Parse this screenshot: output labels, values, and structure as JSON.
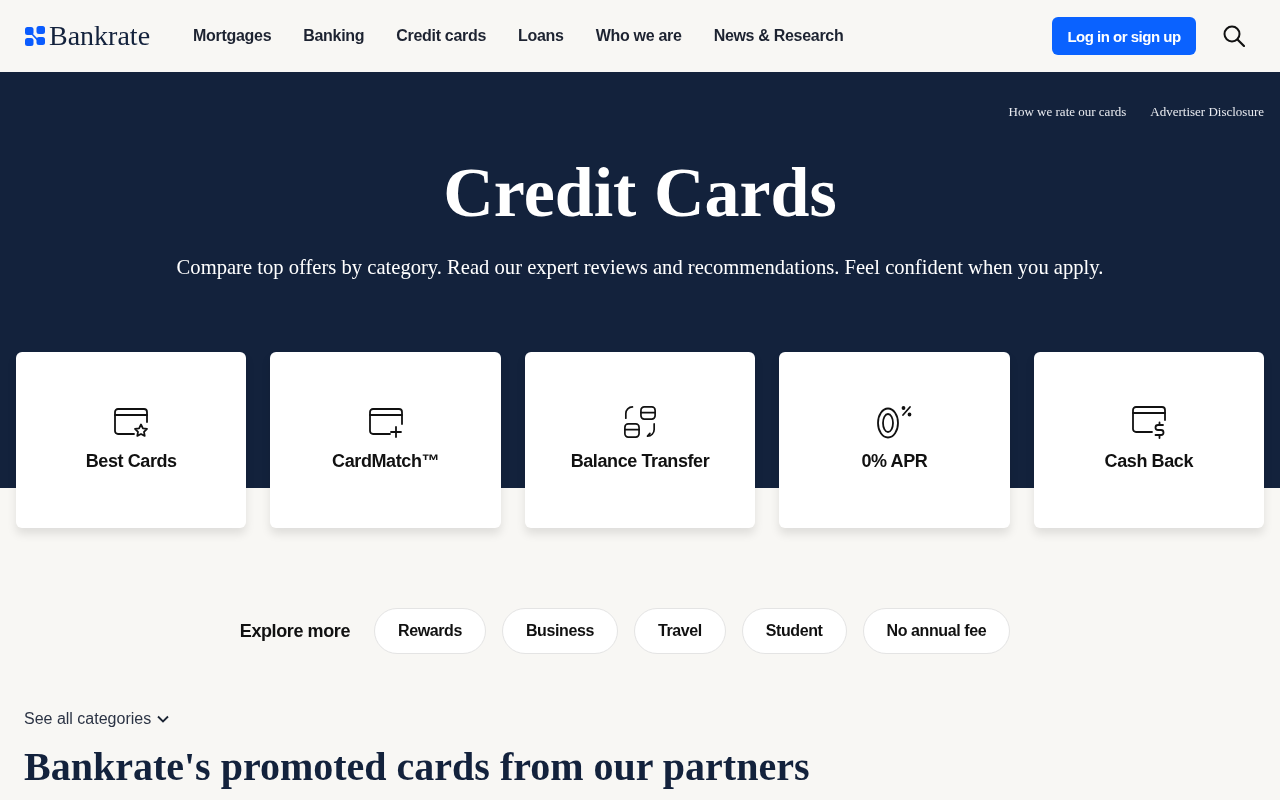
{
  "header": {
    "logo": "Bankrate",
    "nav": [
      "Mortgages",
      "Banking",
      "Credit cards",
      "Loans",
      "Who we are",
      "News & Research"
    ],
    "login_button": "Log in or sign up"
  },
  "hero": {
    "links": [
      "How we rate our cards",
      "Advertiser Disclosure"
    ],
    "title": "Credit Cards",
    "subtitle": "Compare top offers by category. Read our expert reviews and recommendations. Feel confident when you apply."
  },
  "categories": [
    {
      "kind": "star",
      "label": "Best Cards"
    },
    {
      "kind": "plus",
      "label": "CardMatch™"
    },
    {
      "kind": "transfer",
      "label": "Balance Transfer"
    },
    {
      "kind": "percent",
      "label": "0% APR"
    },
    {
      "kind": "dollar",
      "label": "Cash Back"
    }
  ],
  "explore": {
    "label": "Explore more",
    "chips": [
      "Rewards",
      "Business",
      "Travel",
      "Student",
      "No annual fee"
    ]
  },
  "see_all": "See all categories",
  "promoted": {
    "title": "Bankrate's promoted cards from our partners"
  }
}
